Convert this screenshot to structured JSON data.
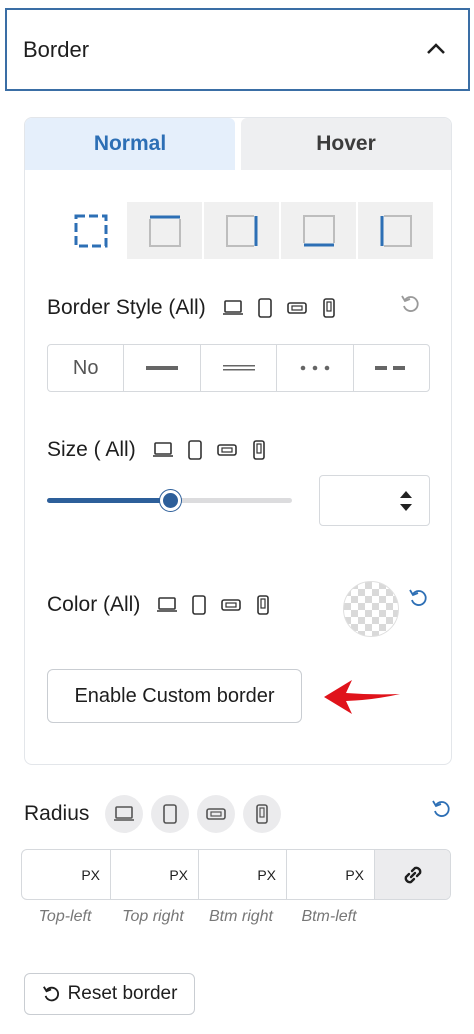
{
  "panel": {
    "title": "Border"
  },
  "tabs": [
    {
      "label": "Normal"
    },
    {
      "label": "Hover"
    }
  ],
  "border_style": {
    "label": "Border Style (All)",
    "options": [
      {
        "label": "No"
      }
    ]
  },
  "size": {
    "label": "Size ( All)",
    "slider_percent": 50,
    "value": ""
  },
  "color": {
    "label": "Color (All)"
  },
  "custom_border": {
    "label": "Enable Custom border"
  },
  "radius": {
    "label": "Radius",
    "inputs": [
      {
        "value": "",
        "unit": "PX",
        "caption": "Top-left"
      },
      {
        "value": "",
        "unit": "PX",
        "caption": "Top right"
      },
      {
        "value": "",
        "unit": "PX",
        "caption": "Btm right"
      },
      {
        "value": "",
        "unit": "PX",
        "caption": "Btm-left"
      }
    ]
  },
  "reset": {
    "label": "Reset border"
  },
  "colors": {
    "accent": "#2d6fb5",
    "slider": "#2d5f9a",
    "arrow": "#e0131b",
    "tab_active_bg": "#e5effb"
  },
  "icons": [
    "chevron-up-icon",
    "laptop-icon",
    "tablet-icon",
    "tablet-landscape-icon",
    "mobile-icon",
    "reset-icon",
    "link-icon",
    "arrow-left-icon"
  ]
}
